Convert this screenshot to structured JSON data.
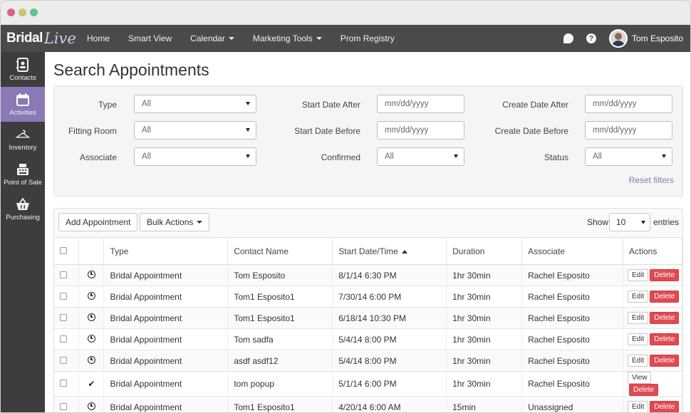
{
  "app": {
    "logo_main": "Bridal",
    "logo_script": "Live"
  },
  "nav": {
    "links": [
      {
        "label": "Home"
      },
      {
        "label": "Smart View"
      },
      {
        "label": "Calendar"
      },
      {
        "label": "Marketing Tools"
      },
      {
        "label": "Prom Registry"
      }
    ],
    "help_icon_text": "?",
    "user_name": "Tom Esposito"
  },
  "sidebar": {
    "items": [
      {
        "label": "Contacts",
        "icon": "contacts-icon"
      },
      {
        "label": "Activities",
        "icon": "calendar-icon"
      },
      {
        "label": "Inventory",
        "icon": "hanger-icon"
      },
      {
        "label": "Point of Sale",
        "icon": "register-icon"
      },
      {
        "label": "Purchasing",
        "icon": "basket-icon"
      }
    ]
  },
  "page": {
    "title": "Search Appointments"
  },
  "filters": {
    "type": {
      "label": "Type",
      "value": "All"
    },
    "fitting_room": {
      "label": "Fitting Room",
      "value": "All"
    },
    "associate": {
      "label": "Associate",
      "value": "All"
    },
    "start_after": {
      "label": "Start Date After",
      "placeholder": "mm/dd/yyyy"
    },
    "start_before": {
      "label": "Start Date Before",
      "placeholder": "mm/dd/yyyy"
    },
    "confirmed": {
      "label": "Confirmed",
      "value": "All"
    },
    "create_after": {
      "label": "Create Date After",
      "placeholder": "mm/dd/yyyy"
    },
    "create_before": {
      "label": "Create Date Before",
      "placeholder": "mm/dd/yyyy"
    },
    "status": {
      "label": "Status",
      "value": "All"
    },
    "reset_label": "Reset filters"
  },
  "toolbar": {
    "add_label": "Add Appointment",
    "bulk_label": "Bulk Actions",
    "show_label": "Show",
    "entries_value": "10",
    "entries_label": "entries"
  },
  "table": {
    "columns": [
      "Type",
      "Contact Name",
      "Start Date/Time",
      "Duration",
      "Associate",
      "Actions"
    ],
    "rows": [
      {
        "icon": "clock",
        "type": "Bridal Appointment",
        "contact": "Tom Esposito",
        "start": "8/1/14 6:30 PM",
        "duration": "1hr 30min",
        "associate": "Rachel Esposito",
        "action1": "Edit",
        "action2": "Delete"
      },
      {
        "icon": "clock",
        "type": "Bridal Appointment",
        "contact": "Tom1 Esposito1",
        "start": "7/30/14 6:00 PM",
        "duration": "1hr 30min",
        "associate": "Rachel Esposito",
        "action1": "Edit",
        "action2": "Delete"
      },
      {
        "icon": "clock",
        "type": "Bridal Appointment",
        "contact": "Tom1 Esposito1",
        "start": "6/18/14 10:30 PM",
        "duration": "1hr 30min",
        "associate": "Rachel Esposito",
        "action1": "Edit",
        "action2": "Delete"
      },
      {
        "icon": "clock",
        "type": "Bridal Appointment",
        "contact": "Tom sadfa",
        "start": "5/4/14 8:00 PM",
        "duration": "1hr 30min",
        "associate": "Rachel Esposito",
        "action1": "Edit",
        "action2": "Delete"
      },
      {
        "icon": "clock",
        "type": "Bridal Appointment",
        "contact": "asdf asdf12",
        "start": "5/4/14 8:00 PM",
        "duration": "1hr 30min",
        "associate": "Rachel Esposito",
        "action1": "Edit",
        "action2": "Delete"
      },
      {
        "icon": "check",
        "type": "Bridal Appointment",
        "contact": "tom popup",
        "start": "5/1/14 6:00 PM",
        "duration": "1hr 30min",
        "associate": "Rachel Esposito",
        "action1": "View",
        "action2": "Delete"
      },
      {
        "icon": "clock",
        "type": "Bridal Appointment",
        "contact": "Tom1 Esposito1",
        "start": "4/20/14 6:00 AM",
        "duration": "15min",
        "associate": "Unassigned",
        "action1": "Edit",
        "action2": "Delete"
      }
    ]
  }
}
